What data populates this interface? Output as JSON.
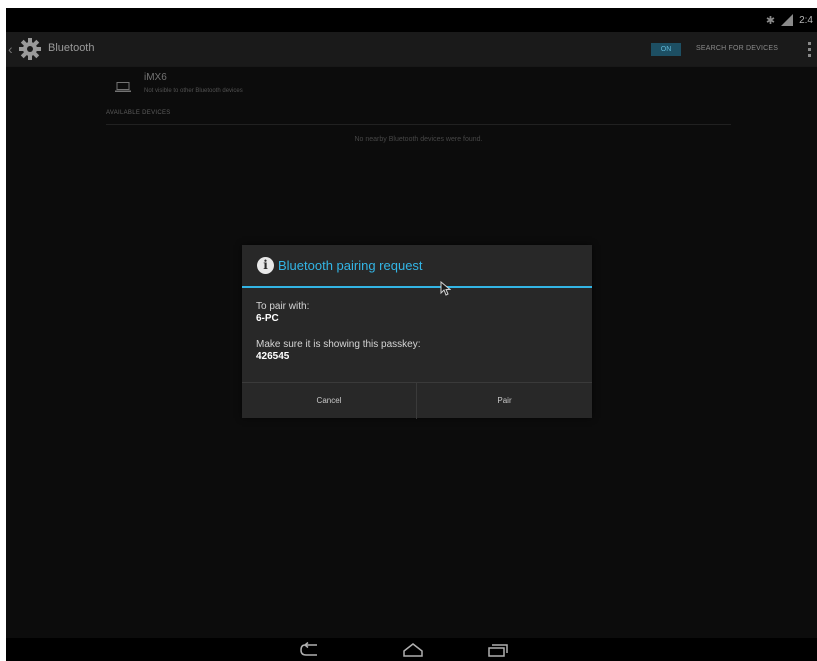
{
  "status_bar": {
    "time": "2:4",
    "bluetooth_glyph": "✱"
  },
  "action_bar": {
    "title": "Bluetooth",
    "toggle_label": "ON",
    "search_label": "SEARCH FOR DEVICES",
    "icons": [
      "gear-icon",
      "overflow-menu-icon"
    ]
  },
  "paired_device": {
    "name": "iMX6",
    "visibility": "Not visible to other Bluetooth devices",
    "icon": "laptop-icon"
  },
  "available": {
    "header": "AVAILABLE DEVICES",
    "empty_message": "No nearby Bluetooth devices were found."
  },
  "dialog": {
    "title": "Bluetooth pairing request",
    "info_glyph": "i",
    "pair_with_label": "To pair with:",
    "device_name": "6-PC",
    "passkey_label": "Make sure it is showing this passkey:",
    "passkey": "426545",
    "cancel_label": "Cancel",
    "pair_label": "Pair"
  },
  "nav_bar": {
    "icons": [
      "back-icon",
      "home-icon",
      "recent-apps-icon"
    ]
  },
  "colors": {
    "accent": "#33b5e5",
    "background": "#101010",
    "dialog": "#282828"
  }
}
